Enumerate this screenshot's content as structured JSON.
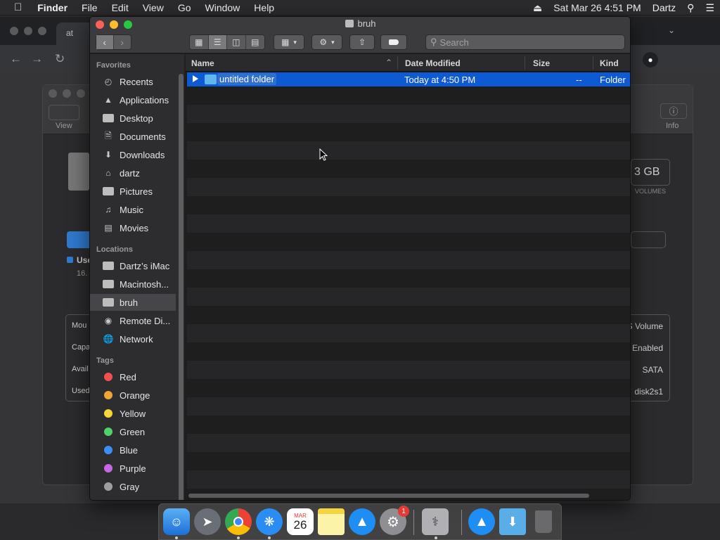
{
  "menubar": {
    "app_name": "Finder",
    "items": [
      "File",
      "Edit",
      "View",
      "Go",
      "Window",
      "Help"
    ],
    "datetime": "Sat Mar 26  4:51 PM",
    "user": "Dartz"
  },
  "background": {
    "browser_tab_label": "at",
    "disk_utility": {
      "view_label": "View",
      "info_label": "Info",
      "capacity_text": "3 GB",
      "volumes_label": "VOLUMES",
      "used_label": "Use",
      "used_value": "16.",
      "left_labels": [
        "Mou",
        "Capa",
        "Avail",
        "Used"
      ],
      "right_values": [
        "S Volume",
        "Enabled",
        "SATA",
        "disk2s1"
      ]
    }
  },
  "finder": {
    "title": "bruh",
    "search_placeholder": "Search",
    "sidebar": {
      "favorites_heading": "Favorites",
      "favorites": [
        {
          "label": "Recents",
          "icon": "clock-icon"
        },
        {
          "label": "Applications",
          "icon": "applications-icon"
        },
        {
          "label": "Desktop",
          "icon": "desktop-icon"
        },
        {
          "label": "Documents",
          "icon": "documents-icon"
        },
        {
          "label": "Downloads",
          "icon": "downloads-icon"
        },
        {
          "label": "dartz",
          "icon": "home-icon"
        },
        {
          "label": "Pictures",
          "icon": "camera-icon"
        },
        {
          "label": "Music",
          "icon": "music-icon"
        },
        {
          "label": "Movies",
          "icon": "film-icon"
        }
      ],
      "locations_heading": "Locations",
      "locations": [
        {
          "label": "Dartz’s iMac",
          "icon": "computer-icon"
        },
        {
          "label": "Macintosh...",
          "icon": "disk-icon"
        },
        {
          "label": "bruh",
          "icon": "disk-icon",
          "selected": true
        },
        {
          "label": "Remote Di...",
          "icon": "optical-disc-icon"
        },
        {
          "label": "Network",
          "icon": "network-icon"
        }
      ],
      "tags_heading": "Tags",
      "tags": [
        {
          "label": "Red",
          "color": "#f0514f"
        },
        {
          "label": "Orange",
          "color": "#f2a33a"
        },
        {
          "label": "Yellow",
          "color": "#f5d63d"
        },
        {
          "label": "Green",
          "color": "#4fd26b"
        },
        {
          "label": "Blue",
          "color": "#3c8ef5"
        },
        {
          "label": "Purple",
          "color": "#c468e6"
        },
        {
          "label": "Gray",
          "color": "#9e9ea2"
        }
      ]
    },
    "columns": {
      "name": "Name",
      "date": "Date Modified",
      "size": "Size",
      "kind": "Kind"
    },
    "rows": [
      {
        "name": "untitled folder",
        "date": "Today at 4:50 PM",
        "size": "--",
        "kind": "Folder",
        "selected": true
      }
    ]
  },
  "dock": {
    "apps": [
      "Finder",
      "Launchpad",
      "Google Chrome",
      "Safari",
      "Calendar",
      "Notes",
      "App Store",
      "System Preferences",
      "Disk Utility",
      "App Store Folder",
      "Downloads Folder",
      "Trash"
    ],
    "calendar_month": "MAR",
    "calendar_day": "26",
    "system_prefs_badge": "1"
  }
}
